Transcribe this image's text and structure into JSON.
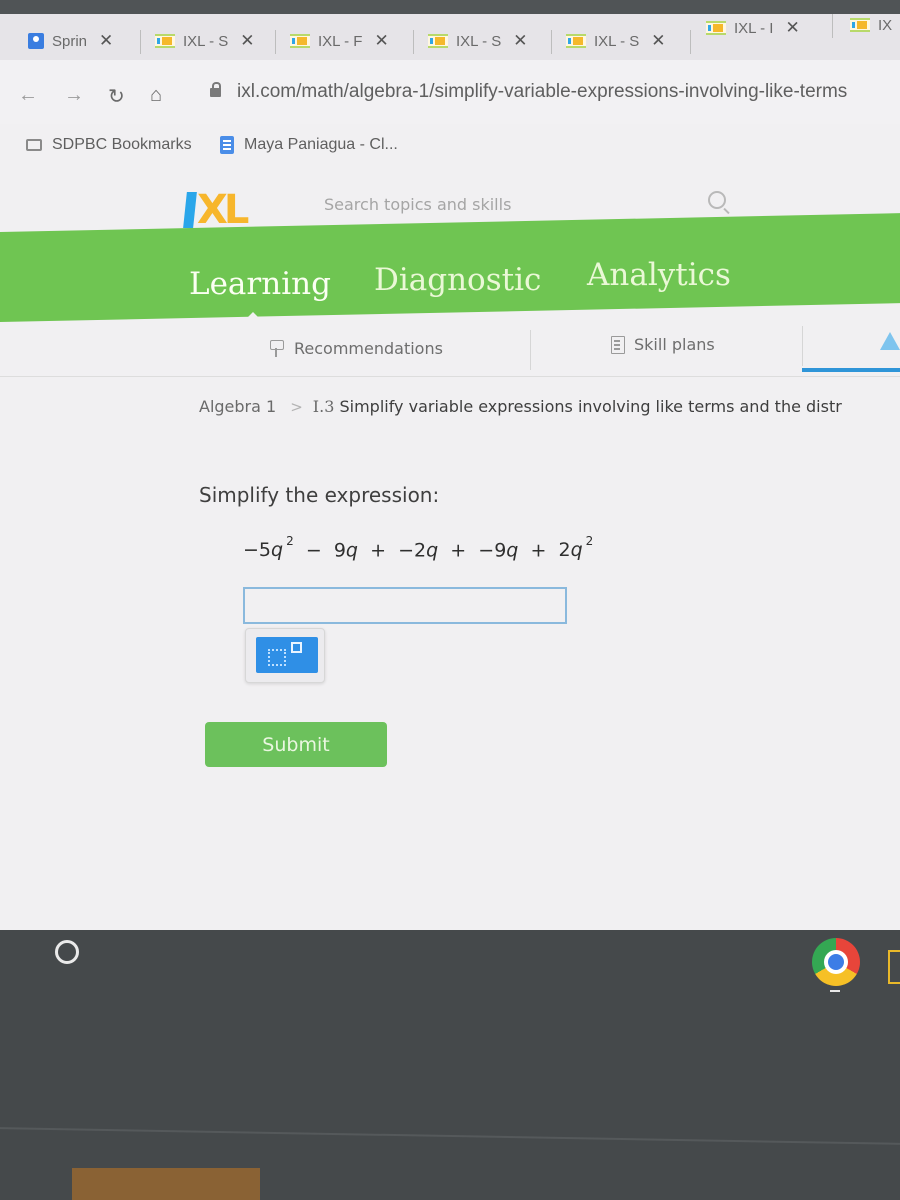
{
  "browser": {
    "tabs": [
      {
        "label": "Sprin",
        "favicon": "sprig-app-icon"
      },
      {
        "label": "IXL - S",
        "favicon": "ixl-favicon"
      },
      {
        "label": "IXL - F",
        "favicon": "ixl-favicon"
      },
      {
        "label": "IXL - S",
        "favicon": "ixl-favicon"
      },
      {
        "label": "IXL - S",
        "favicon": "ixl-favicon"
      },
      {
        "label": "IXL - I",
        "favicon": "ixl-favicon"
      },
      {
        "label": "IX",
        "favicon": "ixl-favicon"
      }
    ],
    "close_glyph": "✕",
    "nav": {
      "back": "←",
      "forward": "→",
      "reload": "↻",
      "home": "⌂"
    },
    "url": "ixl.com/math/algebra-1/simplify-variable-expressions-involving-like-terms",
    "bookmarks": [
      {
        "label": "SDPBC Bookmarks",
        "icon": "folder-icon"
      },
      {
        "label": "Maya Paniagua - Cl...",
        "icon": "google-doc-icon"
      }
    ]
  },
  "ixl": {
    "logo_text": "XL",
    "search_placeholder": "Search topics and skills",
    "nav_tabs": [
      {
        "label": "Learning",
        "active": true
      },
      {
        "label": "Diagnostic",
        "active": false
      },
      {
        "label": "Analytics",
        "active": false
      }
    ],
    "subnav": [
      {
        "label": "Recommendations",
        "icon": "recommendations-icon"
      },
      {
        "label": "Skill plans",
        "icon": "skill-plans-icon"
      },
      {
        "label": "",
        "icon": "awards-icon",
        "active": true
      }
    ],
    "breadcrumb": {
      "subject": "Algebra 1",
      "separator": ">",
      "skill_code": "I.3",
      "skill_name": "Simplify variable expressions involving like terms and the distr"
    },
    "question": {
      "prompt": "Simplify the expression:",
      "terms": [
        {
          "coef": "−5",
          "var": "q",
          "exp": "2"
        },
        {
          "op": "−",
          "coef": "9",
          "var": "q"
        },
        {
          "op": "+",
          "coef": "−2",
          "var": "q"
        },
        {
          "op": "+",
          "coef": "−9",
          "var": "q"
        },
        {
          "op": "+",
          "coef": "2",
          "var": "q",
          "exp": "2"
        }
      ],
      "answer_value": "",
      "exponent_button": "exponent-button"
    },
    "submit_label": "Submit",
    "colors": {
      "nav_green": "#6fc552",
      "submit_green": "#6cc15c",
      "accent_blue": "#2f8fe6",
      "logo_yellow": "#f7b62c",
      "logo_blue": "#2aa6ea"
    }
  },
  "shelf": {
    "apps": [
      "launcher",
      "chrome",
      "files"
    ]
  }
}
